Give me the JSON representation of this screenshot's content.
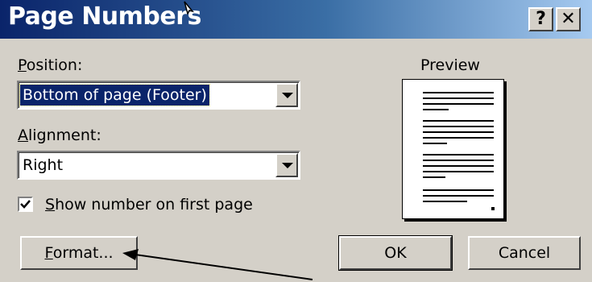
{
  "window": {
    "title": "Page Numbers"
  },
  "titlebar": {
    "help_label": "?",
    "close_label": "✕"
  },
  "position": {
    "label_accel": "P",
    "label_rest": "osition:",
    "value": "Bottom of page (Footer)"
  },
  "alignment": {
    "label_accel": "A",
    "label_rest": "lignment:",
    "value": "Right"
  },
  "first_page": {
    "checked": true,
    "label_accel": "S",
    "label_rest": "how number on first page"
  },
  "preview": {
    "label": "Preview"
  },
  "buttons": {
    "format_accel": "F",
    "format_rest": "ormat...",
    "ok": "OK",
    "cancel": "Cancel"
  }
}
